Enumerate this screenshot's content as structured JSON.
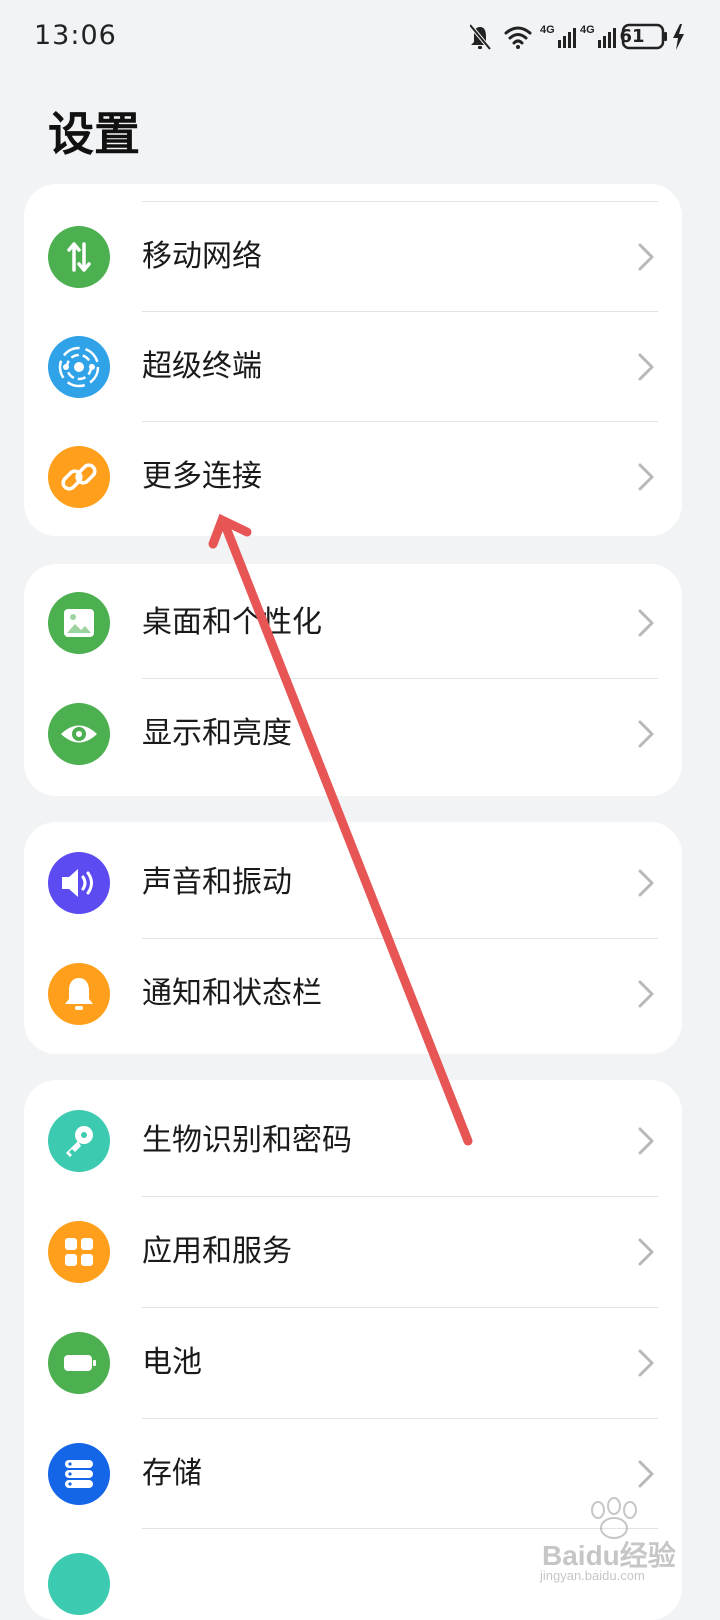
{
  "status_bar": {
    "time": "13:06",
    "battery_level": "61",
    "network_1": "4G",
    "network_2": "4G",
    "icons": [
      "bell-muted-icon",
      "wifi-icon",
      "signal-icon",
      "signal-icon",
      "battery-icon",
      "charging-icon"
    ]
  },
  "page": {
    "title": "设置"
  },
  "groups": [
    {
      "items": [
        {
          "label": "移动网络",
          "icon": "mobile-network-icon",
          "color": "#4caf50"
        },
        {
          "label": "超级终端",
          "icon": "super-device-icon",
          "color": "#2fa2e8"
        },
        {
          "label": "更多连接",
          "icon": "link-icon",
          "color": "#ff9f1c"
        }
      ]
    },
    {
      "items": [
        {
          "label": "桌面和个性化",
          "icon": "wallpaper-icon",
          "color": "#4caf50"
        },
        {
          "label": "显示和亮度",
          "icon": "eye-icon",
          "color": "#4caf50"
        }
      ]
    },
    {
      "items": [
        {
          "label": "声音和振动",
          "icon": "speaker-icon",
          "color": "#5b4bf0"
        },
        {
          "label": "通知和状态栏",
          "icon": "bell-icon",
          "color": "#ff9f1c"
        }
      ]
    },
    {
      "items": [
        {
          "label": "生物识别和密码",
          "icon": "key-icon",
          "color": "#3ccbb0"
        },
        {
          "label": "应用和服务",
          "icon": "apps-grid-icon",
          "color": "#ff9f1c"
        },
        {
          "label": "电池",
          "icon": "battery-icon",
          "color": "#4caf50"
        },
        {
          "label": "存储",
          "icon": "storage-icon",
          "color": "#1565e8"
        }
      ]
    }
  ],
  "annotation": {
    "color": "#e85555"
  },
  "watermark": {
    "text": "Baidu经验",
    "sub": "jingyan.baidu.com"
  }
}
